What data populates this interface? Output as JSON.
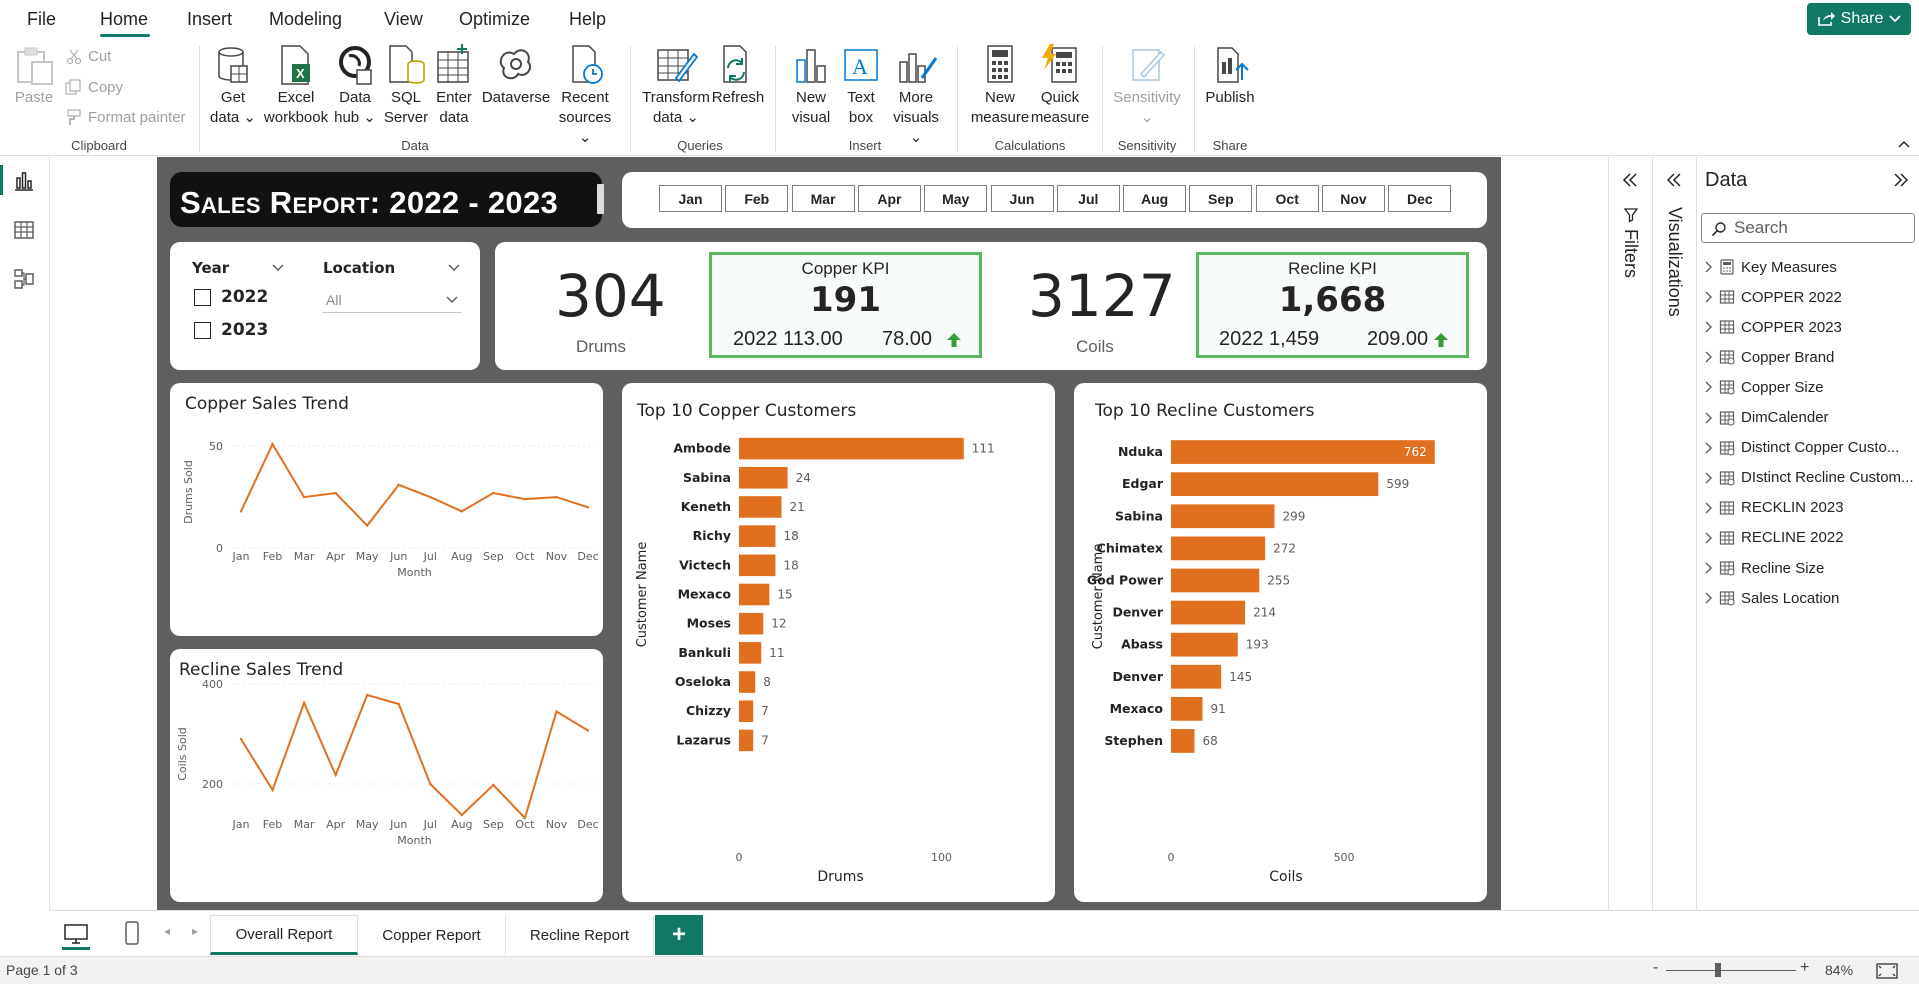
{
  "menu": {
    "tabs": [
      "File",
      "Home",
      "Insert",
      "Modeling",
      "View",
      "Optimize",
      "Help"
    ],
    "share_label": "Share"
  },
  "ribbon": {
    "clipboard": {
      "paste": "Paste",
      "cut": "Cut",
      "copy": "Copy",
      "format_painter": "Format painter",
      "label": "Clipboard"
    },
    "data": {
      "get_data": [
        "Get",
        "data"
      ],
      "excel": [
        "Excel",
        "workbook"
      ],
      "data_hub": [
        "Data",
        "hub"
      ],
      "sql": [
        "SQL",
        "Server"
      ],
      "enter_data": [
        "Enter",
        "data"
      ],
      "dataverse": "Dataverse",
      "recent": [
        "Recent",
        "sources"
      ],
      "label": "Data"
    },
    "queries": {
      "transform": [
        "Transform",
        "data"
      ],
      "refresh": "Refresh",
      "label": "Queries"
    },
    "insert": {
      "new_visual": [
        "New",
        "visual"
      ],
      "text_box": [
        "Text",
        "box"
      ],
      "more_visuals": [
        "More",
        "visuals"
      ],
      "label": "Insert"
    },
    "calculations": {
      "new_measure": [
        "New",
        "measure"
      ],
      "quick_measure": [
        "Quick",
        "measure"
      ],
      "label": "Calculations"
    },
    "sensitivity": {
      "btn": "Sensitivity",
      "label": "Sensitivity"
    },
    "share": {
      "publish": "Publish",
      "label": "Share"
    }
  },
  "report": {
    "title": "Sales Report: 2022 - 2023",
    "months": [
      "Jan",
      "Feb",
      "Mar",
      "Apr",
      "May",
      "Jun",
      "Jul",
      "Aug",
      "Sep",
      "Oct",
      "Nov",
      "Dec"
    ],
    "slicers": {
      "year_label": "Year",
      "years": [
        "2022",
        "2023"
      ],
      "location_label": "Location",
      "location_value": "All"
    },
    "kpis": {
      "drums_value": "304",
      "drums_caption": "Drums",
      "copper_kpi_title": "Copper KPI",
      "copper_kpi_value": "191",
      "copper_kpi_prev": "2022 113.00",
      "copper_kpi_delta": "78.00",
      "coils_value": "3127",
      "coils_caption": "Coils",
      "recline_kpi_title": "Recline KPI",
      "recline_kpi_value": "1,668",
      "recline_kpi_prev": "2022 1,459",
      "recline_kpi_delta": "209.00"
    }
  },
  "chart_data": [
    {
      "type": "line",
      "title": "Copper Sales Trend",
      "xlabel": "Month",
      "ylabel": "Drums Sold",
      "categories": [
        "Jan",
        "Feb",
        "Mar",
        "Apr",
        "May",
        "Jun",
        "Jul",
        "Aug",
        "Sep",
        "Oct",
        "Nov",
        "Dec"
      ],
      "values": [
        18,
        51,
        25,
        27,
        11,
        31,
        25,
        18,
        27,
        24,
        25,
        20
      ],
      "yticks": [
        0,
        50
      ],
      "ylim": [
        0,
        55
      ],
      "color": "#e07020"
    },
    {
      "type": "line",
      "title": "Recline Sales Trend",
      "xlabel": "Month",
      "ylabel": "Coils Sold",
      "categories": [
        "Jan",
        "Feb",
        "Mar",
        "Apr",
        "May",
        "Jun",
        "Jul",
        "Aug",
        "Sep",
        "Oct",
        "Nov",
        "Dec"
      ],
      "values": [
        290,
        188,
        362,
        218,
        378,
        360,
        200,
        138,
        198,
        132,
        345,
        307
      ],
      "yticks": [
        200,
        400
      ],
      "ylim": [
        100,
        420
      ],
      "color": "#e07020"
    },
    {
      "type": "bar",
      "orientation": "horizontal",
      "title": "Top 10 Copper Customers",
      "xlabel": "Drums",
      "ylabel": "Customer Name",
      "categories": [
        "Ambode",
        "Sabina",
        "Keneth",
        "Richy",
        "Victech",
        "Mexaco",
        "Moses",
        "Bankuli",
        "Oseloka",
        "Chizzy",
        "Lazarus"
      ],
      "values": [
        111,
        24,
        21,
        18,
        18,
        15,
        12,
        11,
        8,
        7,
        7
      ],
      "xticks": [
        0,
        100
      ],
      "xlim": [
        0,
        120
      ],
      "color": "#e07020"
    },
    {
      "type": "bar",
      "orientation": "horizontal",
      "title": "Top 10 Recline Customers",
      "xlabel": "Coils",
      "ylabel": "Customer Name",
      "categories": [
        "Nduka",
        "Edgar",
        "Sabina",
        "Chimatex",
        "God Power",
        "Denver",
        "Abass",
        "Denver",
        "Mexaco",
        "Stephen"
      ],
      "values": [
        762,
        599,
        299,
        272,
        255,
        214,
        193,
        145,
        91,
        68
      ],
      "xticks": [
        0,
        500
      ],
      "xlim": [
        0,
        780
      ],
      "color": "#e07020"
    }
  ],
  "data_pane": {
    "title": "Data",
    "search_placeholder": "Search",
    "items": [
      "Key Measures",
      "COPPER 2022",
      "COPPER 2023",
      "Copper Brand",
      "Copper Size",
      "DimCalender",
      "Distinct Copper Custo...",
      "DIstinct Recline Custom...",
      "RECKLIN 2023",
      "RECLINE 2022",
      "Recline Size",
      "Sales Location"
    ]
  },
  "side_panes": {
    "filters": "Filters",
    "visualizations": "Visualizations"
  },
  "pages": {
    "tabs": [
      "Overall Report",
      "Copper Report",
      "Recline Report"
    ],
    "add": "+"
  },
  "status": {
    "page": "Page 1 of 3",
    "zoom": "84%"
  },
  "colors": {
    "accent": "#117865",
    "bar": "#e07020",
    "kpi_border": "#5cb85c",
    "canvas": "#5f5f5f"
  }
}
